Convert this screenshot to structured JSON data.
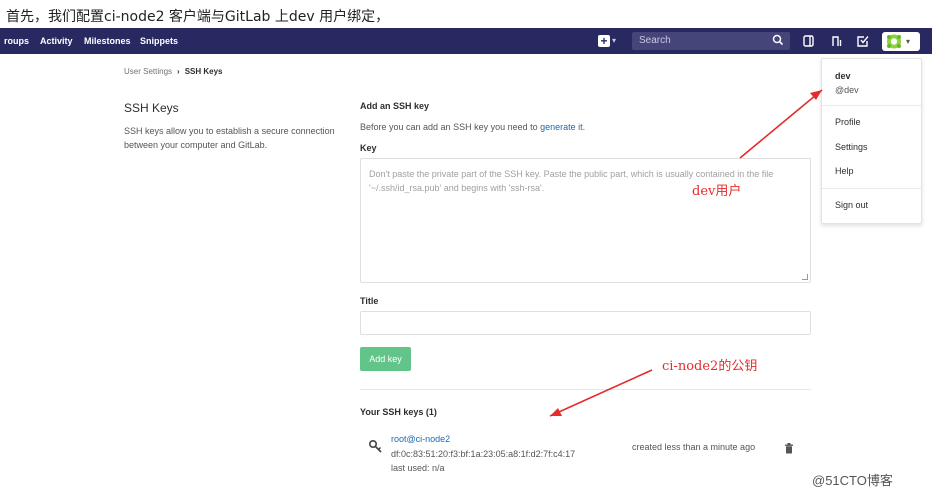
{
  "caption": "首先，我们配置ci-node2 客户端与GitLab 上dev 用户绑定，",
  "navbar": {
    "links": [
      "roups",
      "Activity",
      "Milestones",
      "Snippets"
    ],
    "search_placeholder": "Search",
    "color": "#292961"
  },
  "breadcrumb": {
    "parent": "User Settings",
    "current": "SSH Keys"
  },
  "left": {
    "title": "SSH Keys",
    "description": "SSH keys allow you to establish a secure connection between your computer and GitLab."
  },
  "form": {
    "heading": "Add an SSH key",
    "intro_text": "Before you can add an SSH key you need to ",
    "intro_link": "generate it.",
    "key_label": "Key",
    "key_placeholder": "Don't paste the private part of the SSH key. Paste the public part, which is usually contained in the file '~/.ssh/id_rsa.pub' and begins with 'ssh-rsa'.",
    "title_label": "Title",
    "add_button": "Add key"
  },
  "keys": {
    "heading": "Your SSH keys (1)",
    "items": [
      {
        "name": "root@ci-node2",
        "fingerprint": "df:0c:83:51:20:f3:bf:1a:23:05:a8:1f:d2:7f:c4:17",
        "last_used": "last used: n/a",
        "created": "created less than a minute ago"
      }
    ]
  },
  "user_dropdown": {
    "name": "dev",
    "handle": "@dev",
    "items": [
      "Profile",
      "Settings",
      "Help"
    ],
    "sign_out": "Sign out"
  },
  "annotations": {
    "dev_user": "dev用户",
    "public_key": "ci-node2的公钥",
    "color": "#e52b2b"
  },
  "watermark": "@51CTO博客"
}
